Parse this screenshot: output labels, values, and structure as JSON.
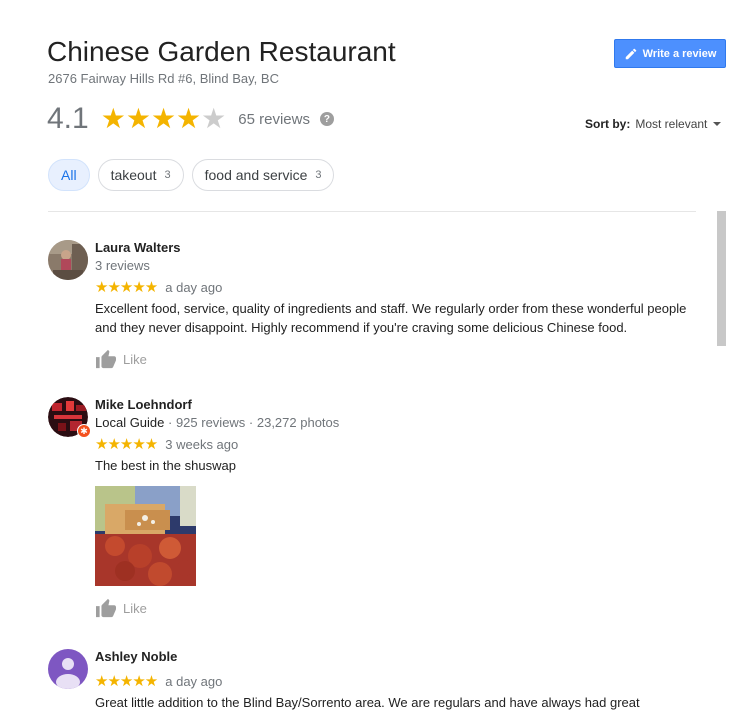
{
  "header": {
    "title": "Chinese Garden Restaurant",
    "address": "2676 Fairway Hills Rd #6, Blind Bay, BC",
    "write_review_label": "Write a review"
  },
  "summary": {
    "rating": "4.1",
    "stars_filled": 4,
    "review_count": "65 reviews",
    "help_icon": "?"
  },
  "sort": {
    "label": "Sort by:",
    "value": "Most relevant"
  },
  "filters": [
    {
      "label": "All",
      "count": ""
    },
    {
      "label": "takeout",
      "count": "3"
    },
    {
      "label": "food and service",
      "count": "3"
    }
  ],
  "reviews": [
    {
      "name": "Laura Walters",
      "meta": "3 reviews",
      "stars": "★★★★★",
      "time": "a day ago",
      "text": "Excellent food, service, quality of ingredients and staff. We regularly order from these wonderful people and they never disappoint. Highly recommend if you're craving some delicious Chinese food.",
      "like_label": "Like"
    },
    {
      "name": "Mike Loehndorf",
      "badge": "Local Guide",
      "meta": " · 925 reviews · 23,272 photos",
      "stars": "★★★★★",
      "time": "3 weeks ago",
      "text": "The best in the shuswap",
      "like_label": "Like"
    },
    {
      "name": "Ashley Noble",
      "stars": "★★★★★",
      "time": "a day ago",
      "text": "Great little addition to the Blind Bay/Sorrento area. We are regulars and have always had great"
    }
  ],
  "colors": {
    "star": "#f4b400",
    "primary_button": "#4d90fe",
    "chip_active_bg": "#e8f0fe",
    "chip_active_text": "#1a73e8",
    "avatar_purple": "#7e57c2"
  }
}
